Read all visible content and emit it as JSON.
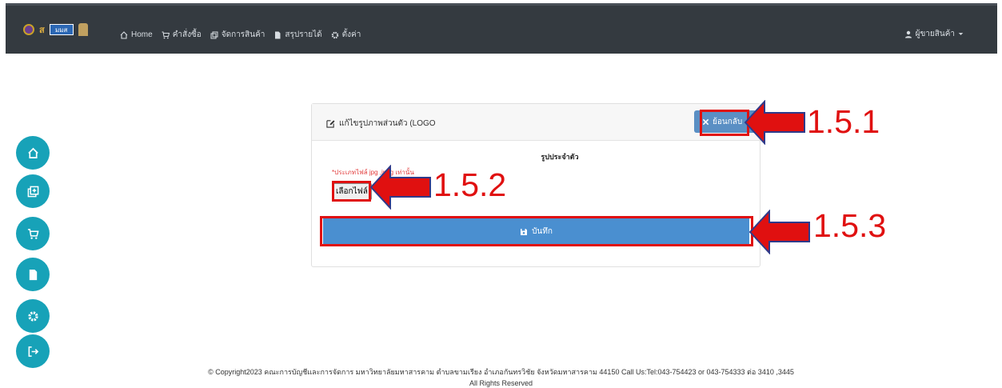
{
  "navbar": {
    "logo_mark": "ส",
    "logo_badge": "มมส",
    "links": [
      {
        "label": "Home",
        "icon": "home-icon"
      },
      {
        "label": "คำสั่งซื้อ",
        "icon": "cart-icon"
      },
      {
        "label": "จัดการสินค้า",
        "icon": "product-icon"
      },
      {
        "label": "สรุปรายได้",
        "icon": "report-icon"
      },
      {
        "label": "ตั้งค่า",
        "icon": "gear-icon"
      }
    ],
    "user_label": "ผู้ขายสินค้า"
  },
  "sidebar": {
    "buttons": [
      {
        "icon": "home-icon"
      },
      {
        "icon": "add-product-icon"
      },
      {
        "icon": "cart-icon"
      },
      {
        "icon": "document-icon"
      },
      {
        "icon": "gear-icon"
      },
      {
        "icon": "logout-icon"
      }
    ]
  },
  "card": {
    "title": "แก้ไขรูปภาพส่วนตัว (LOGO",
    "back_label": "ย้อนกลับ",
    "section_label": "รูปประจำตัว",
    "hint": "*ประเภทไฟล์ jpg ,jpeg เท่านั้น",
    "file_button_label": "เลือกไฟล์",
    "save_label": "บันทึก"
  },
  "annotations": {
    "step1": "1.5.1",
    "step2": "1.5.2",
    "step3": "1.5.3"
  },
  "footer": {
    "line1": "© Copyright2023 คณะการบัญชีและการจัดการ มหาวิทยาลัยมหาสารคาม ตำบลขามเรียง อำเภอกันทรวิชัย จังหวัดมหาสารคาม 44150 Call Us:Tel:043-754423 or 043-754333 ต่อ 3410 ,3445",
    "line2": "All Rights Reserved"
  },
  "colors": {
    "navbar": "#343a40",
    "side_button": "#17a2b8",
    "save_button": "#4a8fd0",
    "back_button": "#5a8fc4",
    "annotation": "#e01010",
    "hint": "#e23b3b"
  }
}
